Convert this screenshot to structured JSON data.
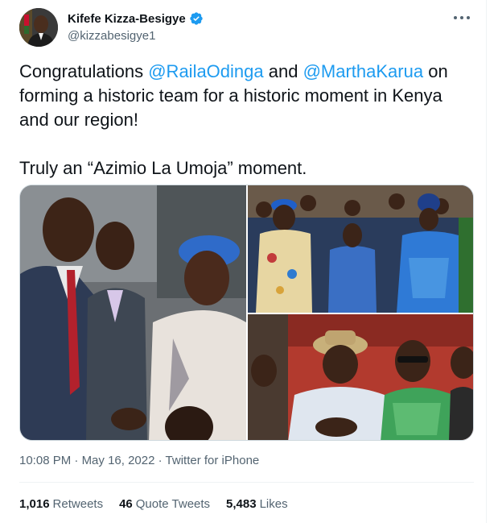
{
  "author": {
    "display_name": "Kifefe Kizza-Besigye",
    "handle": "@kizzabesigye1",
    "verified": true
  },
  "icons": {
    "verified": "verified-badge-icon",
    "more": "more-options-icon"
  },
  "tweet": {
    "line1_prefix": "Congratulations ",
    "mention1": "@RailaOdinga",
    "line1_middle": " and ",
    "mention2": "@MarthaKarua",
    "line1_suffix": " on forming a historic team for a historic moment in Kenya and our region!",
    "line2": "Truly an “Azimio La Umoja” moment."
  },
  "meta": {
    "time": "10:08 PM",
    "separator1": " · ",
    "date": "May 16, 2022",
    "separator2": " · ",
    "source": "Twitter for iPhone"
  },
  "stats": {
    "retweets_count": "1,016",
    "retweets_label": "Retweets",
    "quotes_count": "46",
    "quotes_label": "Quote Tweets",
    "likes_count": "5,483",
    "likes_label": "Likes"
  },
  "colors": {
    "link": "#1d9bf0",
    "text": "#0f1419",
    "secondary": "#536471",
    "border": "#cfd9de"
  }
}
